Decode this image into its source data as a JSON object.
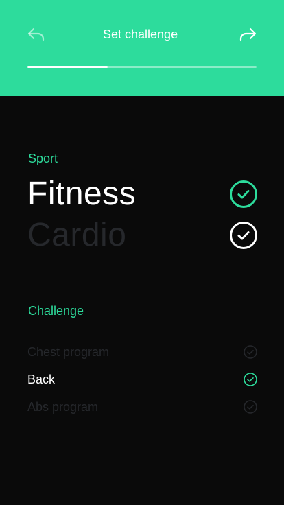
{
  "header": {
    "title": "Set challenge",
    "progress_fraction": 0.35,
    "back_icon": "reply-arrow-icon",
    "forward_icon": "forward-arrow-icon"
  },
  "sport": {
    "label": "Sport",
    "options": [
      {
        "name": "Fitness",
        "state": "selected"
      },
      {
        "name": "Cardio",
        "state": "unselected"
      }
    ]
  },
  "challenge": {
    "label": "Challenge",
    "options": [
      {
        "name": "Chest program",
        "state": "unselected"
      },
      {
        "name": "Back",
        "state": "selected"
      },
      {
        "name": "Abs program",
        "state": "unselected"
      }
    ]
  },
  "colors": {
    "accent": "#2ddc9c",
    "background": "#0a0a0a",
    "dim_text": "#26282c",
    "text": "#ffffff"
  }
}
